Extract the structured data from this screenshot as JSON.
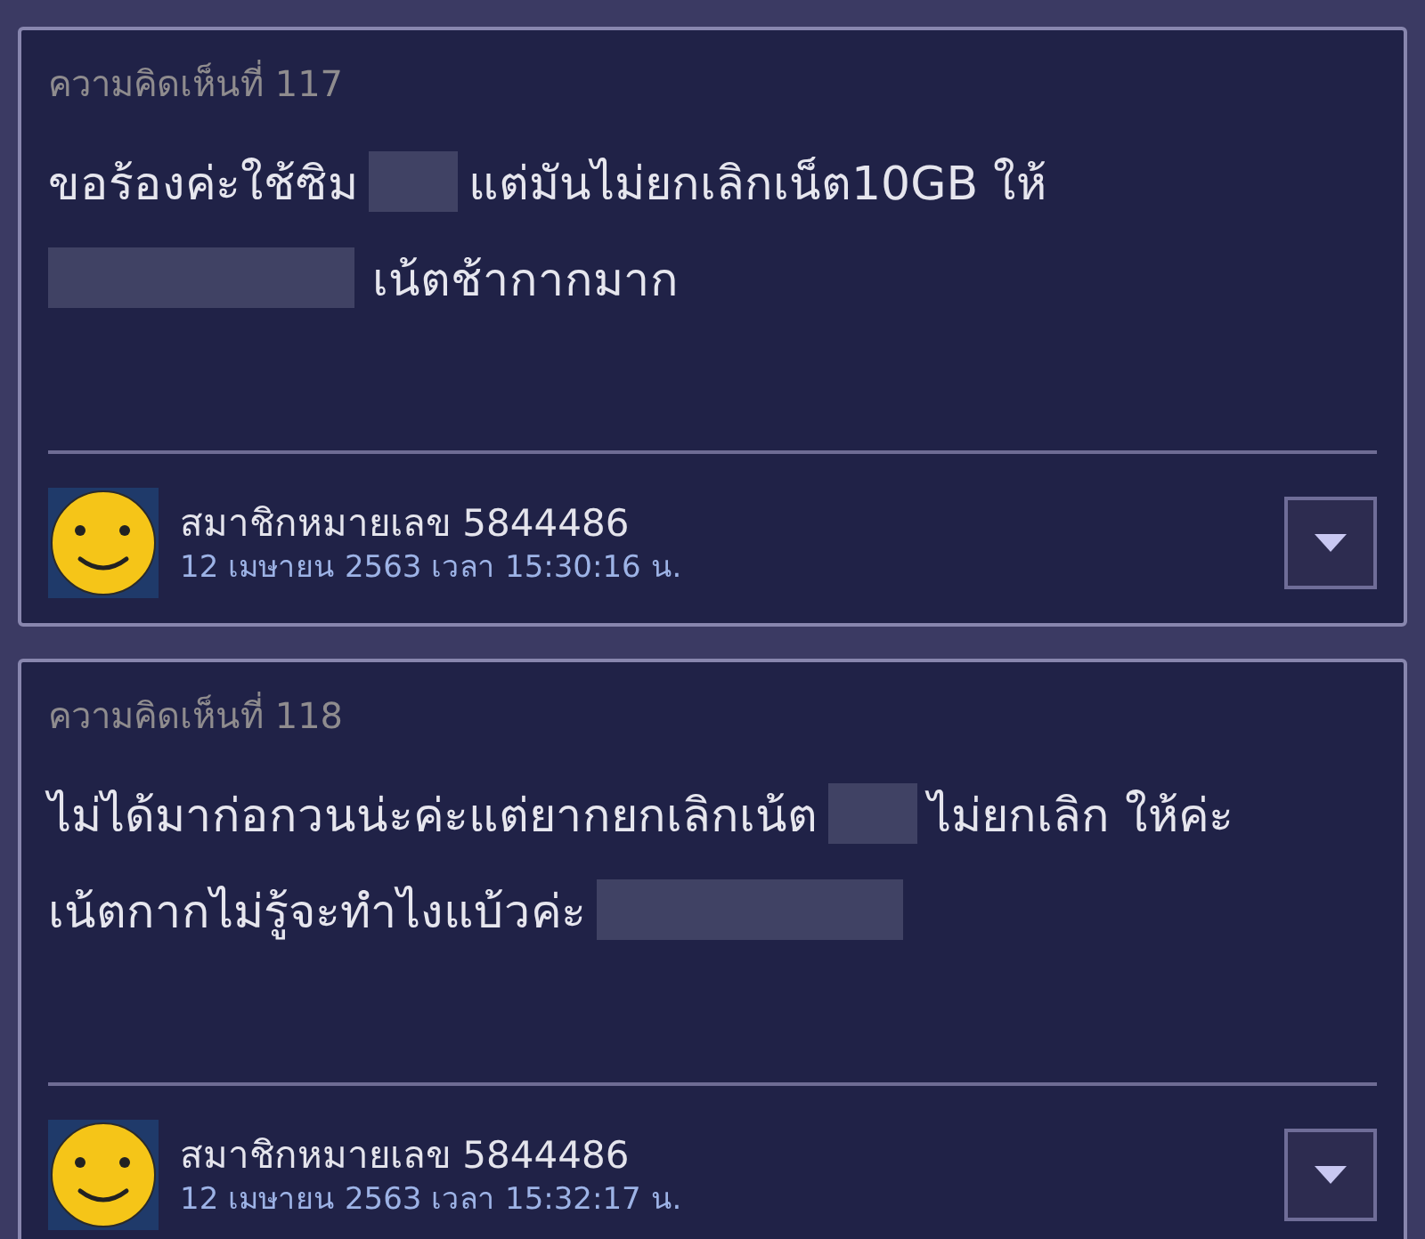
{
  "comments": [
    {
      "header": "ความคิดเห็นที่ 117",
      "body_lines": [
        [
          {
            "kind": "text",
            "text": "ขอร้องค่ะใช้ซิม"
          },
          {
            "kind": "redaction"
          },
          {
            "kind": "text",
            "text": "แต่มันไม่ยกเลิกเน็ต10GB ให้"
          }
        ],
        [
          {
            "kind": "wideredaction"
          },
          {
            "kind": "text",
            "text": "เน้ตช้ากากมาก"
          }
        ]
      ],
      "author": "สมาชิกหมายเลข 5844486",
      "date": "12 เมษายน 2563 เวลา 15:30:16 น."
    },
    {
      "header": "ความคิดเห็นที่ 118",
      "body_lines": [
        [
          {
            "kind": "text",
            "text": "ไม่ได้มาก่อกวนน่ะค่ะแต่ยากยกเลิกเน้ต"
          },
          {
            "kind": "redaction"
          },
          {
            "kind": "text",
            "text": "ไม่ยกเลิก ให้ค่ะ"
          }
        ],
        [
          {
            "kind": "text",
            "text": "เน้ตกากไม่รู้จะทำไงแบ้วค่ะ"
          },
          {
            "kind": "wideredaction"
          }
        ]
      ],
      "author": "สมาชิกหมายเลข 5844486",
      "date": "12 เมษายน 2563 เวลา 15:32:17 น."
    }
  ]
}
